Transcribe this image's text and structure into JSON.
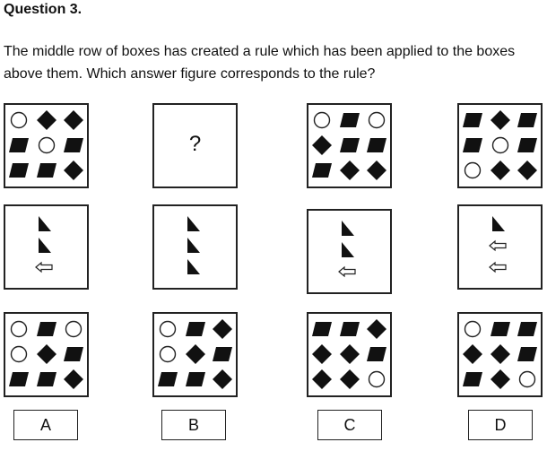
{
  "question": {
    "title": "Question 3.",
    "prompt": "The middle row of boxes has created a rule which has been applied to the boxes above them. Which answer figure corresponds to the rule?"
  },
  "top_row": [
    {
      "grid": [
        [
          "circle",
          "diamond",
          "diamond"
        ],
        [
          "square",
          "circle",
          "square"
        ],
        [
          "square",
          "square",
          "diamond"
        ]
      ]
    },
    {
      "mark": "?"
    },
    {
      "grid": [
        [
          "circle",
          "square",
          "circle"
        ],
        [
          "diamond",
          "square",
          "square"
        ],
        [
          "square",
          "diamond",
          "diamond"
        ]
      ]
    },
    {
      "grid": [
        [
          "square",
          "diamond",
          "square"
        ],
        [
          "square",
          "circle",
          "square"
        ],
        [
          "circle",
          "diamond",
          "diamond"
        ]
      ]
    }
  ],
  "middle_row": [
    {
      "icons": [
        "triangle",
        "triangle",
        "left-arrow"
      ]
    },
    {
      "icons": [
        "triangle",
        "triangle",
        "triangle"
      ]
    },
    {
      "icons": [
        "triangle",
        "triangle",
        "left-arrow"
      ]
    },
    {
      "icons": [
        "triangle",
        "left-arrow",
        "left-arrow"
      ]
    }
  ],
  "options": [
    {
      "label": "A",
      "grid": [
        [
          "circle",
          "square",
          "circle"
        ],
        [
          "circle",
          "diamond",
          "square"
        ],
        [
          "square",
          "square",
          "diamond"
        ]
      ]
    },
    {
      "label": "B",
      "grid": [
        [
          "circle",
          "square",
          "diamond"
        ],
        [
          "circle",
          "diamond",
          "square"
        ],
        [
          "square",
          "square",
          "diamond"
        ]
      ]
    },
    {
      "label": "C",
      "grid": [
        [
          "square",
          "square",
          "diamond"
        ],
        [
          "diamond",
          "diamond",
          "square"
        ],
        [
          "diamond",
          "diamond",
          "circle"
        ]
      ]
    },
    {
      "label": "D",
      "grid": [
        [
          "circle",
          "square",
          "square"
        ],
        [
          "diamond",
          "diamond",
          "square"
        ],
        [
          "square",
          "diamond",
          "circle"
        ]
      ]
    }
  ]
}
